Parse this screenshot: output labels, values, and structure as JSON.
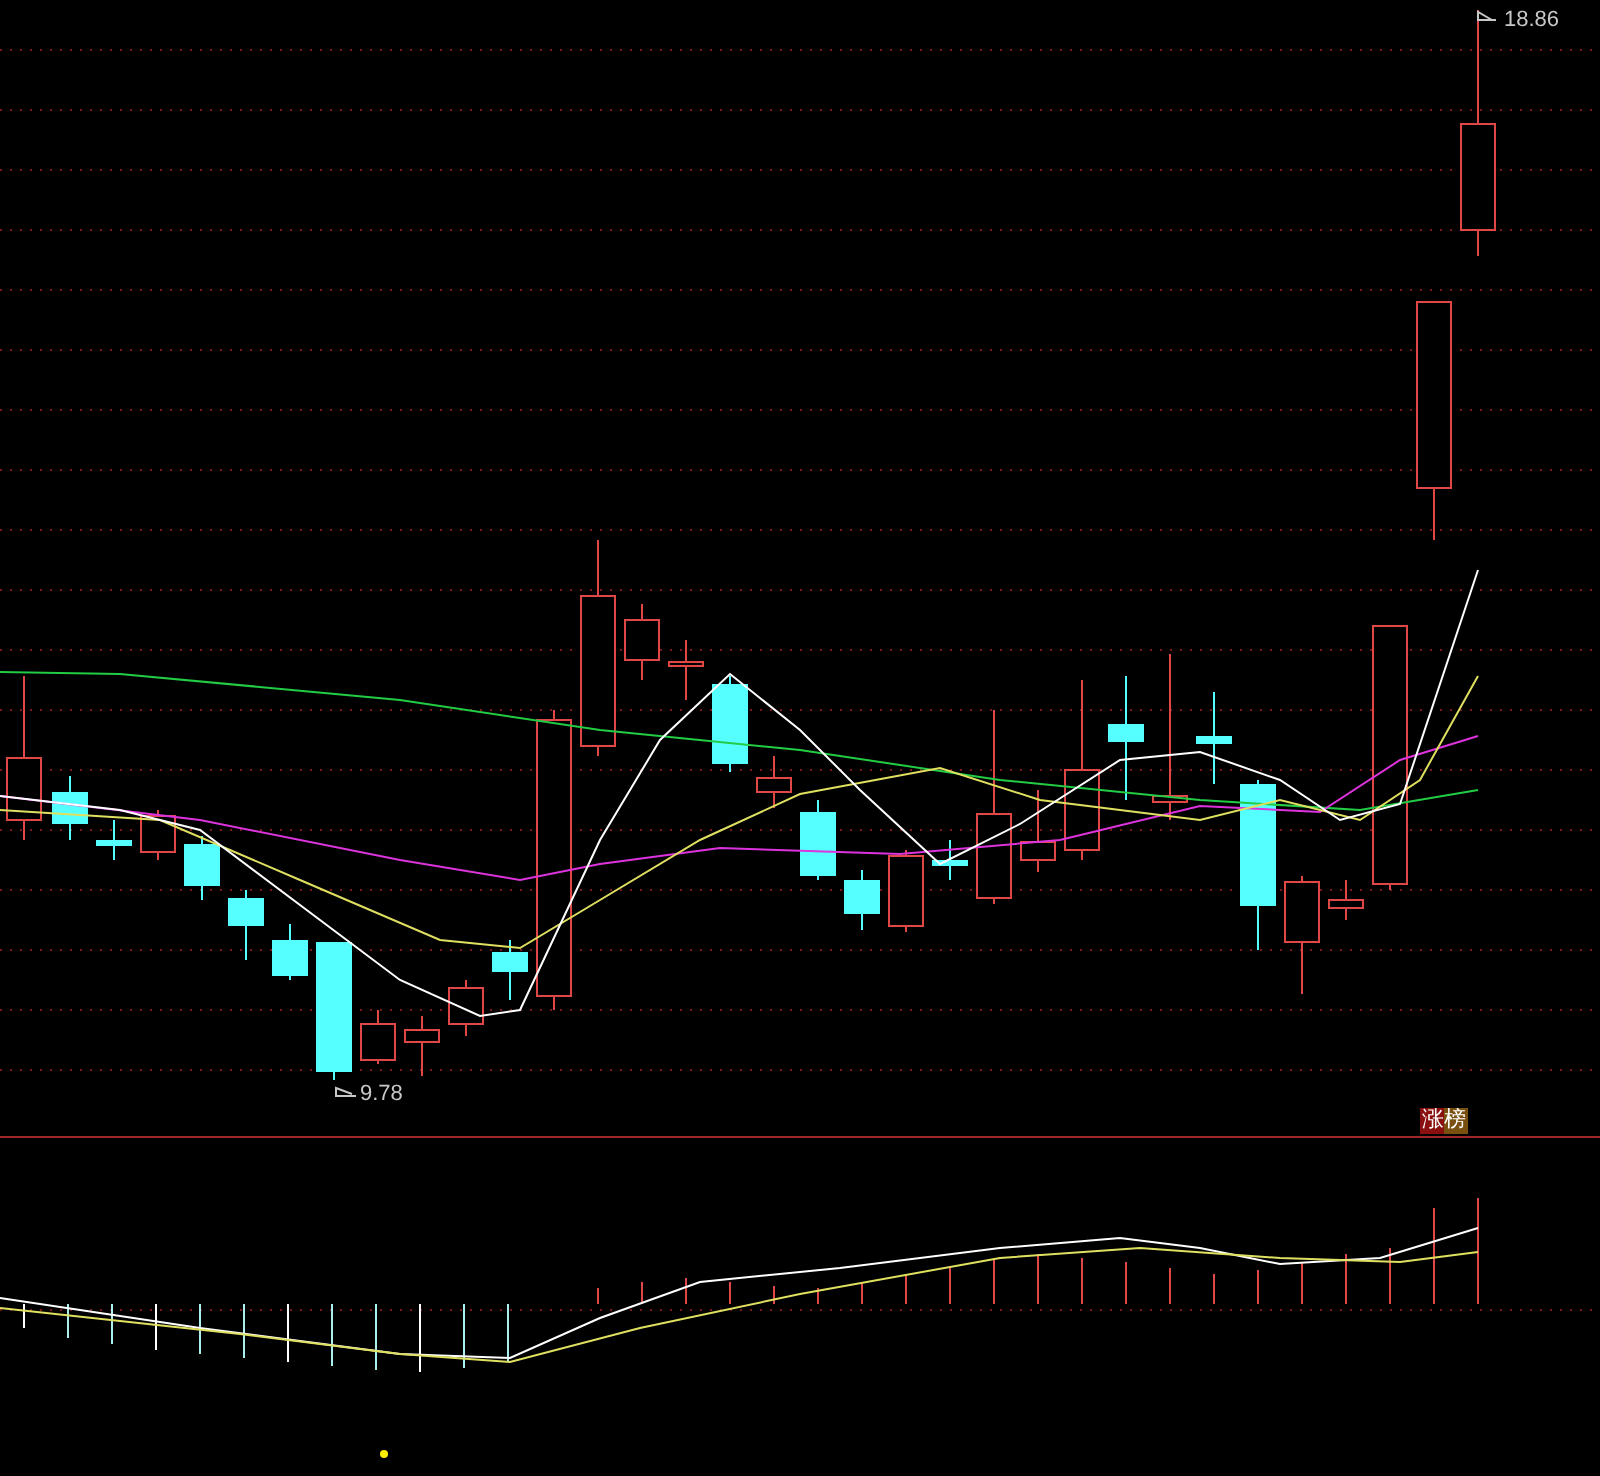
{
  "main_chart": {
    "high_label": "18.86",
    "low_label": "9.78"
  },
  "indicator_badge": "涨榜"
}
